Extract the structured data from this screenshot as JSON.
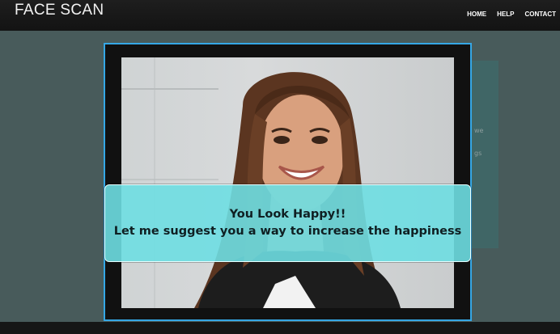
{
  "navbar": {
    "brand": "FACE SCAN",
    "links": [
      {
        "label": "HOME"
      },
      {
        "label": "HELP"
      },
      {
        "label": "CONTACT"
      }
    ]
  },
  "background": {
    "card_text_1": "we",
    "card_text_2": "gs"
  },
  "result": {
    "headline": "You Look Happy!!",
    "message": "Let me suggest you a way to increase the happiness"
  },
  "colors": {
    "frame_border": "#35a7e6",
    "banner": "#6edee2",
    "navbar": "#1a1a1a"
  }
}
